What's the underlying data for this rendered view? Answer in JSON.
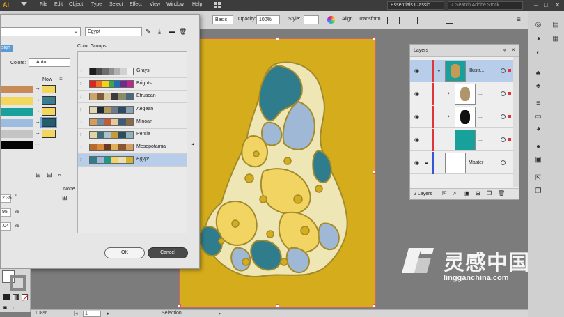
{
  "app": {
    "logo": "Ai",
    "menu": [
      "File",
      "Edit",
      "Object",
      "Type",
      "Select",
      "Effect",
      "View",
      "Window",
      "Help"
    ],
    "workspace": "Essentials Classic",
    "search_placeholder": "Search Adobe Stock"
  },
  "control_bar": {
    "stroke_profile": "Basic",
    "opacity_label": "Opacity:",
    "opacity_value": "100%",
    "style_label": "Style:",
    "align": "Align",
    "transform": "Transform"
  },
  "recolor_dialog": {
    "preset_name": "Egypt",
    "tab_label": "sign",
    "colors_label": "Colors:",
    "colors_value": "Auto",
    "new_label": "Now",
    "none_label": "None",
    "field_values": [
      "2.35",
      "95",
      ".04"
    ],
    "field_units": [
      "°",
      "%",
      "%"
    ],
    "color_groups_label": "Color Groups",
    "groups": [
      {
        "name": "Grays",
        "colors": [
          "#1e1e1e",
          "#4a4a4a",
          "#6d6d6d",
          "#8f8f8f",
          "#b0b0b0",
          "#d1d1d1",
          "#f0f0f0"
        ]
      },
      {
        "name": "Brights",
        "colors": [
          "#e2231a",
          "#f26f21",
          "#f7d117",
          "#3aa845",
          "#1d6fb8",
          "#6d2d8e",
          "#c2248f"
        ]
      },
      {
        "name": "Etruscan",
        "colors": [
          "#c9a56b",
          "#7c5a3a",
          "#d9c7a1",
          "#3c3c3c",
          "#8c8c6c",
          "#4a6a7a"
        ]
      },
      {
        "name": "Aegean",
        "colors": [
          "#e2d6b2",
          "#1f2a35",
          "#b39859",
          "#6d7c8a",
          "#2f4a63",
          "#8aa1b4"
        ]
      },
      {
        "name": "Minoan",
        "colors": [
          "#d99a5a",
          "#6d8ca2",
          "#c35b3a",
          "#e6c89a",
          "#3a5c77",
          "#8b6a4a"
        ]
      },
      {
        "name": "Persia",
        "colors": [
          "#e3d3a8",
          "#3d6e79",
          "#a9c2cf",
          "#c69b3c",
          "#2a4f5a",
          "#8fb1bb"
        ]
      },
      {
        "name": "Mesopotamia",
        "colors": [
          "#b9692b",
          "#d48b3c",
          "#6b3a22",
          "#e0b15a",
          "#8a5530",
          "#d1a062"
        ]
      },
      {
        "name": "Egypt",
        "colors": [
          "#2f7d8c",
          "#9fb8d6",
          "#1a9a8c",
          "#f1d462",
          "#e7e0b5",
          "#d6b22a"
        ]
      }
    ],
    "color_rows": [
      {
        "current": "#c88b57",
        "new": "#f2d75c"
      },
      {
        "current": "#f2d75c",
        "new": "#3b7c8e"
      },
      {
        "current": "#18a09a",
        "new": "#f2d75c"
      },
      {
        "current": "#9cbde0",
        "new": "#1f5f6e"
      },
      {
        "current": "#c4c4c4",
        "new": "#f2d75c"
      },
      {
        "current": "#050505",
        "new": ""
      }
    ],
    "ok_label": "OK",
    "cancel_label": "Cancel"
  },
  "layers_panel": {
    "title": "Layers",
    "rows": [
      {
        "name": "Illustr...",
        "selected": true
      },
      {
        "name": "...",
        "selected": false
      },
      {
        "name": "...",
        "selected": false
      },
      {
        "name": "...",
        "selected": false
      },
      {
        "name": "Master",
        "selected": false
      }
    ],
    "count": "2 Layers"
  },
  "status_bar": {
    "zoom": "108%",
    "page": "1",
    "tool": "Selection"
  },
  "watermark": {
    "title": "灵感中国",
    "url": "lingganchina.com"
  },
  "colors": {
    "artboard": "#d5ad1c",
    "selection": "#b8cdea",
    "teal": "#2f7d8c",
    "light_blue": "#9fb8d6",
    "yellow": "#f1d462",
    "cream": "#efe6b6"
  }
}
